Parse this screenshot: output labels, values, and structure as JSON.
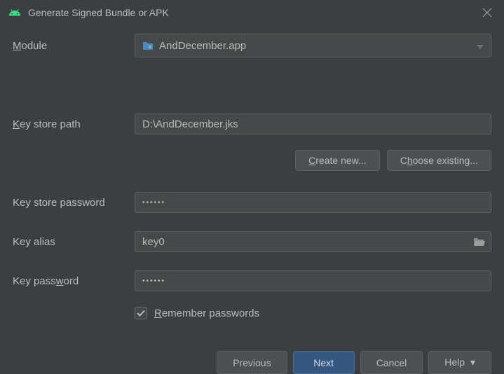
{
  "titlebar": {
    "title": "Generate Signed Bundle or APK"
  },
  "form": {
    "module_label_pre": "M",
    "module_label_rest": "odule",
    "module_value": "AndDecember.app",
    "keystore_path_label_pre": "K",
    "keystore_path_label_rest": "ey store path",
    "keystore_path_value": "D:\\AndDecember.jks",
    "create_new_pre": "C",
    "create_new_rest": "reate new...",
    "choose_existing_pre": "C",
    "choose_existing_mid": "h",
    "choose_existing_rest": "oose existing...",
    "keystore_password_label": "Key store password",
    "keystore_password_value": "••••••",
    "key_alias_label": "Key alias",
    "key_alias_value": "key0",
    "key_password_label_pre": "Key pass",
    "key_password_label_u": "w",
    "key_password_label_rest": "ord",
    "key_password_value": "••••••",
    "remember_pre": "R",
    "remember_rest": "emember passwords"
  },
  "footer": {
    "previous": "Previous",
    "next": "Next",
    "cancel": "Cancel",
    "help": "Help"
  }
}
